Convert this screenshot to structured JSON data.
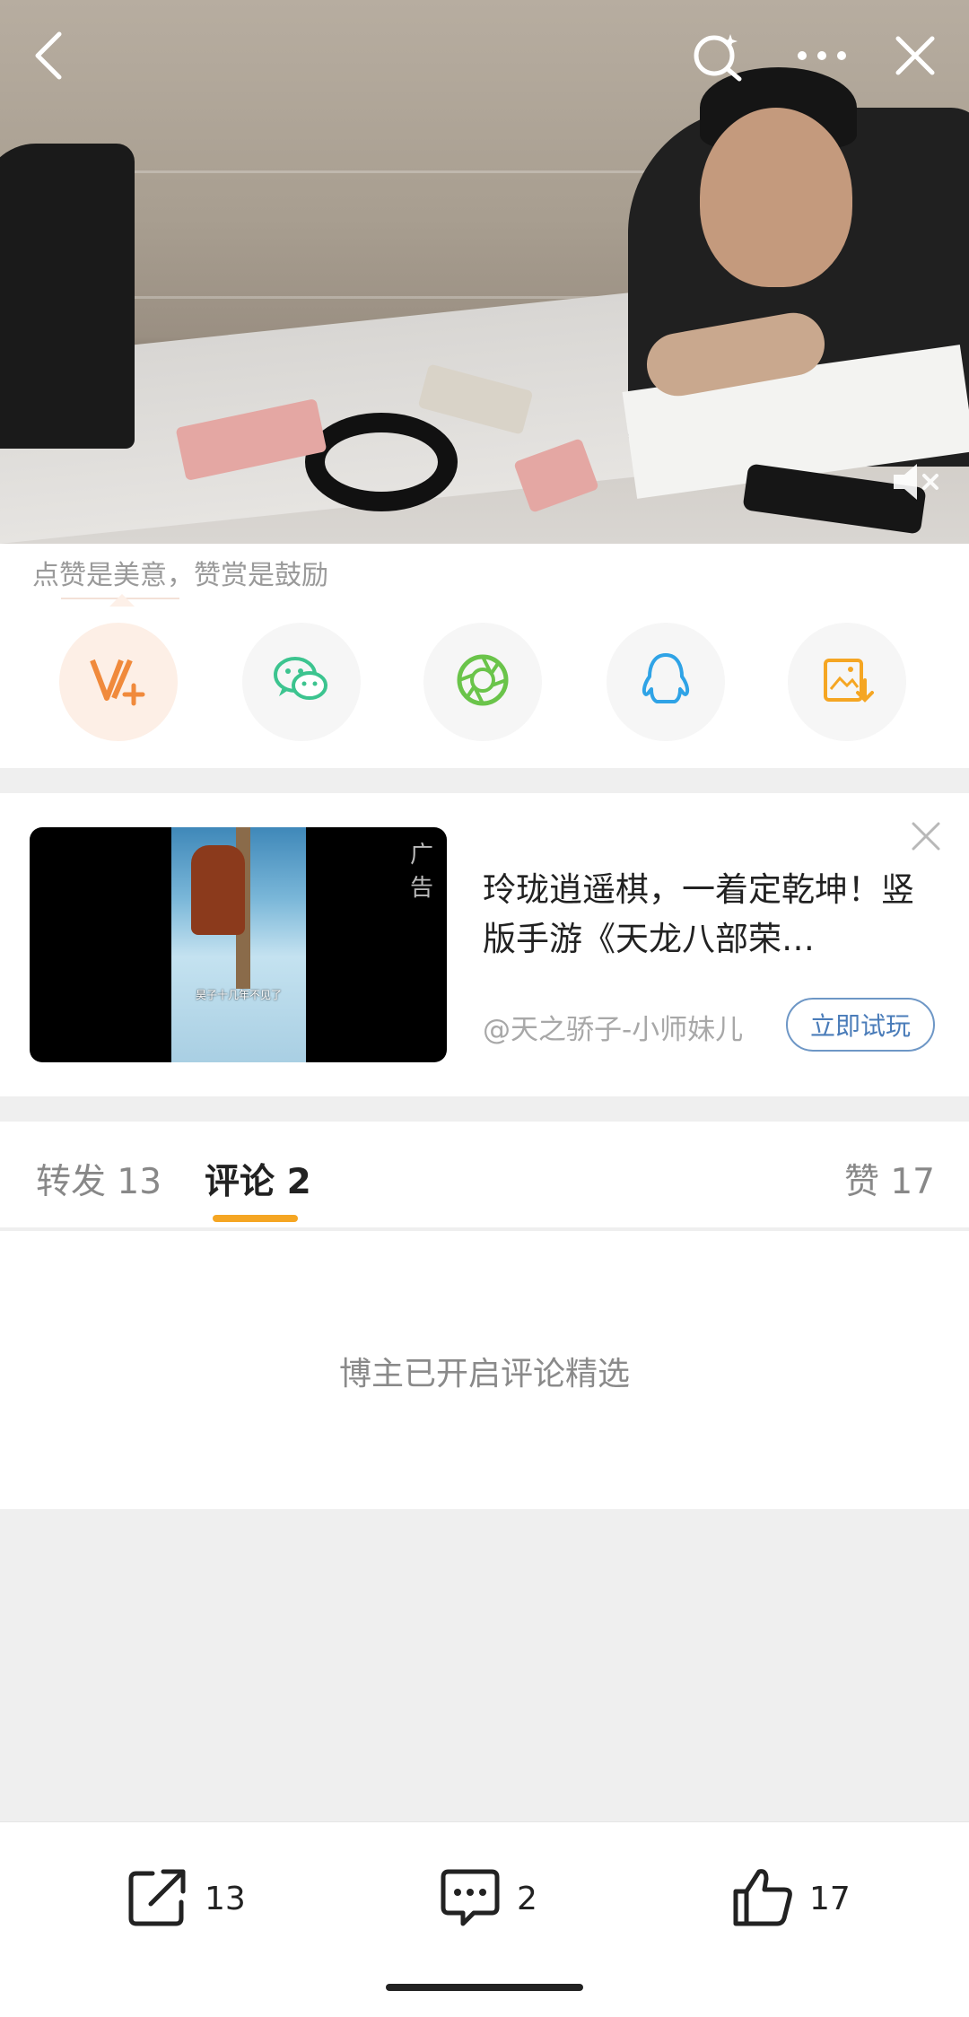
{
  "reward": {
    "text": "点赞是美意，赞赏是鼓励",
    "options": [
      {
        "icon": "v-plus-reward-icon"
      },
      {
        "icon": "wechat-icon"
      },
      {
        "icon": "moments-icon"
      },
      {
        "icon": "qq-icon"
      },
      {
        "icon": "save-image-icon"
      }
    ]
  },
  "ad": {
    "label": "广告",
    "title": "玲珑逍遥棋，一着定乾坤！竖版手游《天龙八部荣…",
    "author": "@天之骄子-小师妹儿",
    "button": "立即试玩",
    "video_subtitle": "昊子十几年不见了"
  },
  "tabs": {
    "repost": "转发 13",
    "comment": "评论 2",
    "like": "赞 17"
  },
  "notice": "博主已开启评论精选",
  "bottom_bar": {
    "repost_count": "13",
    "comment_count": "2",
    "like_count": "17"
  },
  "colors": {
    "accent": "#f5a623",
    "reward": "#f08a3c",
    "wechat": "#3cc48f",
    "moments": "#6ac44a",
    "qq": "#2fa3e6",
    "save": "#f5a623",
    "link": "#4a7cb9"
  }
}
